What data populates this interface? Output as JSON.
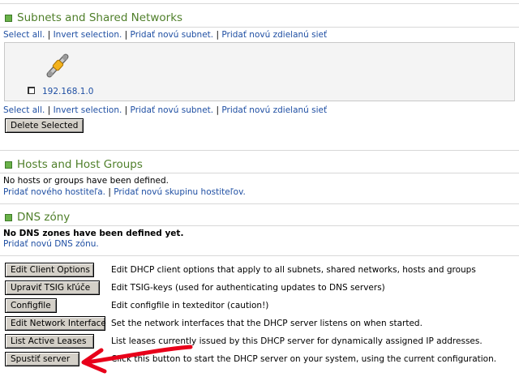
{
  "subnets": {
    "title": "Subnets and Shared Networks",
    "links": [
      "Select all.",
      "Invert selection.",
      "Pridať novú subnet.",
      "Pridať novú zdielanú sieť"
    ],
    "items": [
      {
        "label": "192.168.1.0",
        "icon": "network-cable-icon"
      }
    ],
    "delete_label": "Delete Selected"
  },
  "hosts": {
    "title": "Hosts and Host Groups",
    "empty_text": "No hosts or groups have been defined.",
    "links": [
      "Pridať nového hostiteľa.",
      "Pridať novú skupinu hostiteľov."
    ]
  },
  "dns": {
    "title": "DNS zóny",
    "empty_text": "No DNS zones have been defined yet.",
    "link": "Pridať novú DNS zónu."
  },
  "actions": [
    {
      "label": "Edit Client Options",
      "description": "Edit DHCP client options that apply to all subnets, shared networks, hosts and groups"
    },
    {
      "label": "Upraviť TSIG kľúče",
      "description": "Edit TSIG-keys (used for authenticating updates to DNS servers)"
    },
    {
      "label": "Configfile",
      "description": "Edit configfile in texteditor (caution!)"
    },
    {
      "label": "Edit Network Interface",
      "description": "Set the network interfaces that the DHCP server listens on when started."
    },
    {
      "label": "List Active Leases",
      "description": "List leases currently issued by this DHCP server for dynamically assigned IP addresses."
    },
    {
      "label": "Spustiť server",
      "description": "Click this button to start the DHCP server on your system, using the current configuration."
    }
  ],
  "colors": {
    "section_title": "#4f7f2a",
    "link": "#1f4fa3",
    "annotation_arrow": "#e8001a"
  }
}
